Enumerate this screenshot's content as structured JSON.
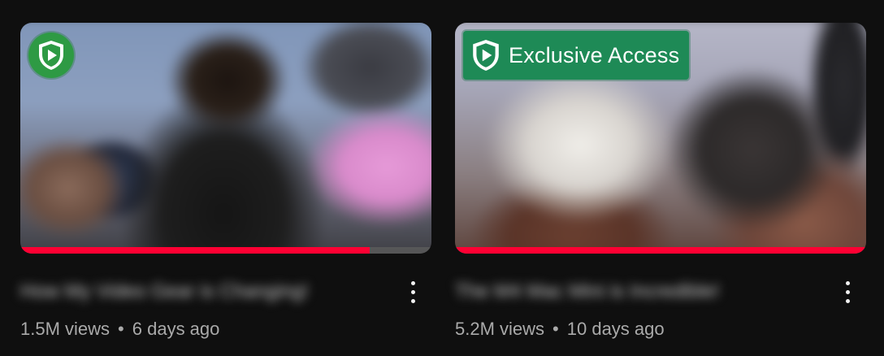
{
  "colors": {
    "background": "#0f0f0f",
    "progress": "#ff0033",
    "badge_green": "#1e8a56",
    "badge_circle": "#2e9a44",
    "meta_text": "#aaaaaa"
  },
  "videos": [
    {
      "title": "How My Video Gear is Changing!",
      "views": "1.5M views",
      "separator": "•",
      "age": "6 days ago",
      "badge": {
        "icon": "shield-play-icon",
        "label": ""
      },
      "watch_progress": 0.85,
      "more_icon": "more-vert-icon"
    },
    {
      "title": "The M4 Mac Mini is Incredible!",
      "views": "5.2M views",
      "separator": "•",
      "age": "10 days ago",
      "badge": {
        "icon": "shield-play-icon",
        "label": "Exclusive Access"
      },
      "watch_progress": 1.0,
      "more_icon": "more-vert-icon"
    }
  ]
}
